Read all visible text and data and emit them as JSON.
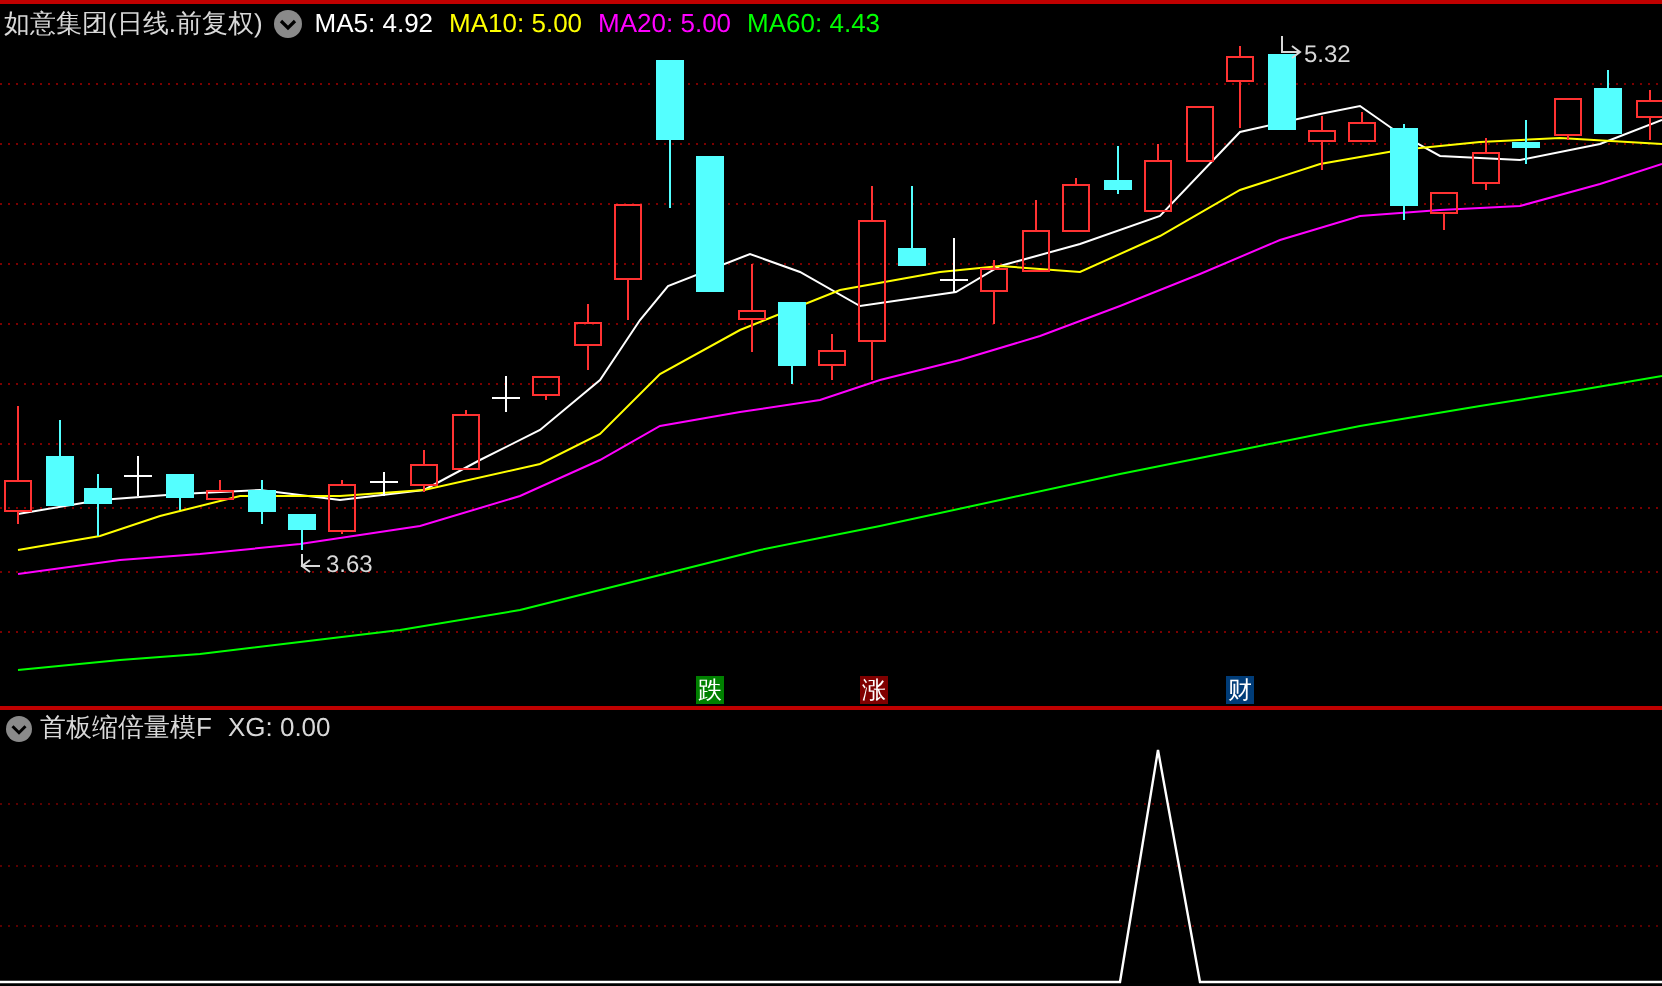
{
  "main_panel": {
    "title": "如意集团(日线.前复权)",
    "legend": [
      {
        "label": "MA5: 4.92",
        "color": "#ffffff"
      },
      {
        "label": "MA10: 5.00",
        "color": "#ffff00"
      },
      {
        "label": "MA20: 5.00",
        "color": "#ff00ff"
      },
      {
        "label": "MA60: 4.43",
        "color": "#00ff00"
      }
    ],
    "high_label": "5.32",
    "low_label": "3.63",
    "event_markers": [
      {
        "label": "跌",
        "color": "#008000"
      },
      {
        "label": "涨",
        "color": "#800000"
      },
      {
        "label": "财",
        "color": "#003c78"
      }
    ]
  },
  "indicator_panel": {
    "title": "首板缩倍量模F",
    "reading": "XG: 0.00"
  }
}
